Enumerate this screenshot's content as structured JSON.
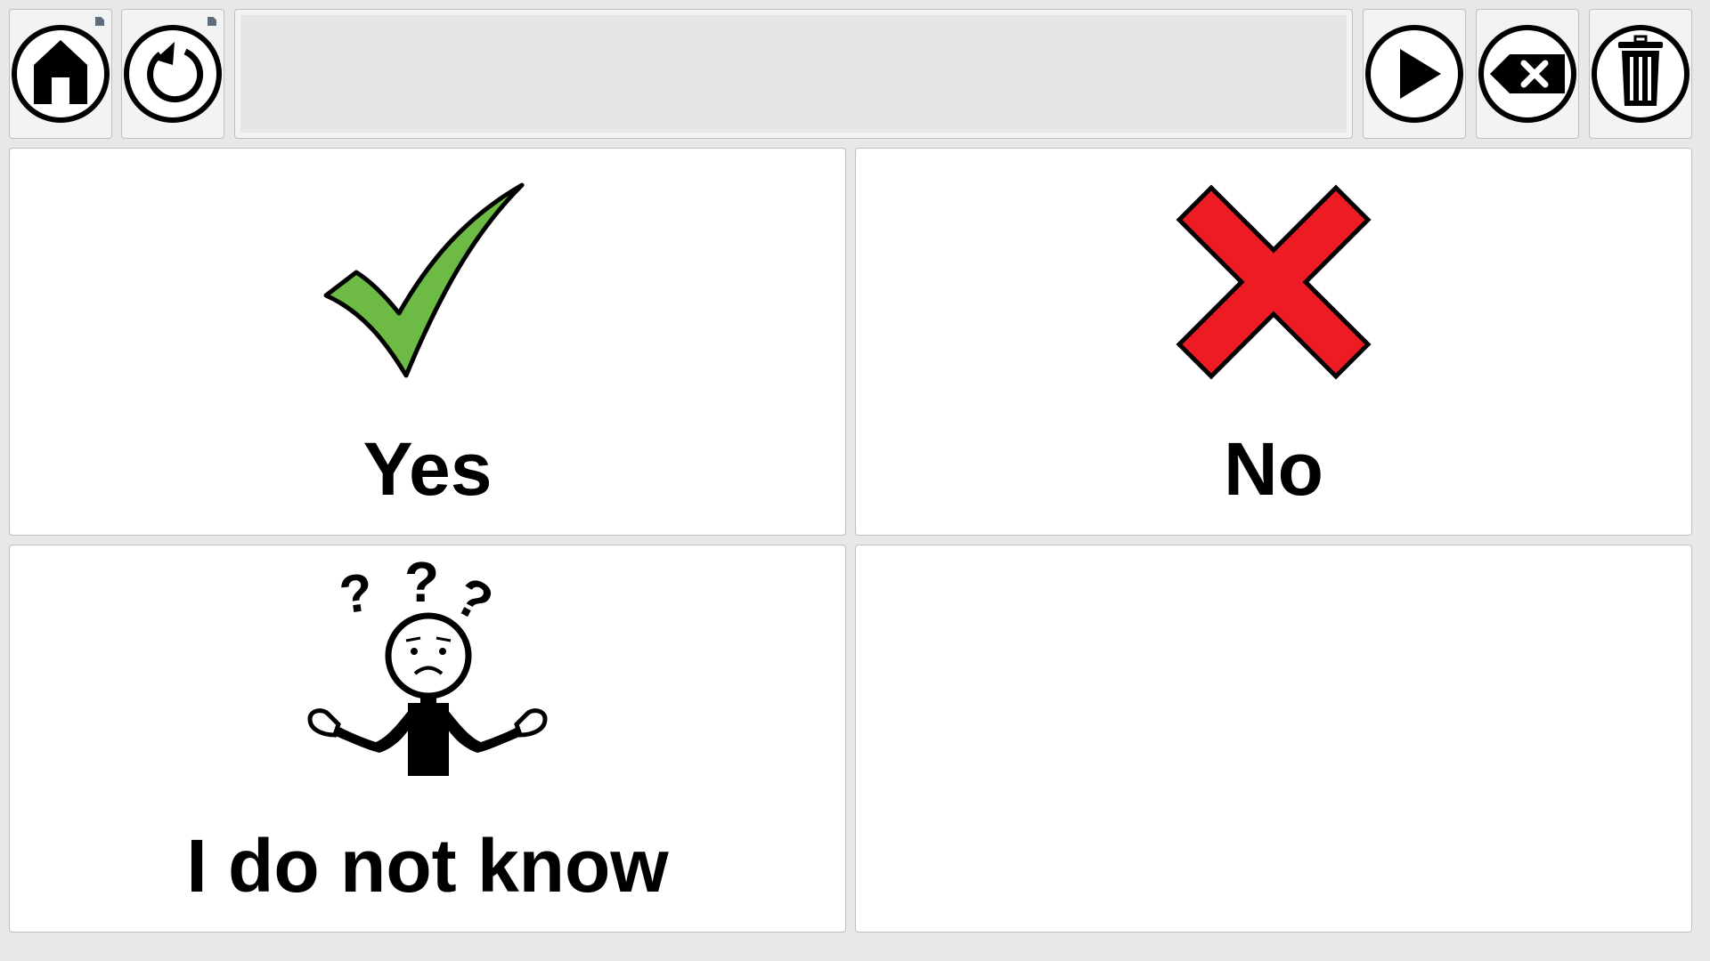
{
  "toolbar": {
    "home_icon": "home-icon",
    "back_icon": "back-arrow-icon",
    "speak_icon": "play-icon",
    "backspace_icon": "backspace-icon",
    "clear_icon": "trash-icon",
    "message_text": ""
  },
  "grid": {
    "cells": [
      {
        "label": "Yes",
        "icon": "checkmark-icon",
        "icon_color": "#6dbb45"
      },
      {
        "label": "No",
        "icon": "red-x-icon",
        "icon_color": "#ed1c24"
      },
      {
        "label": "I do not know",
        "icon": "confused-person-icon"
      },
      {
        "label": "",
        "icon": ""
      }
    ]
  },
  "colors": {
    "background": "#e8e8e8",
    "cell_background": "#ffffff",
    "message_bar": "#e6e6e6"
  }
}
